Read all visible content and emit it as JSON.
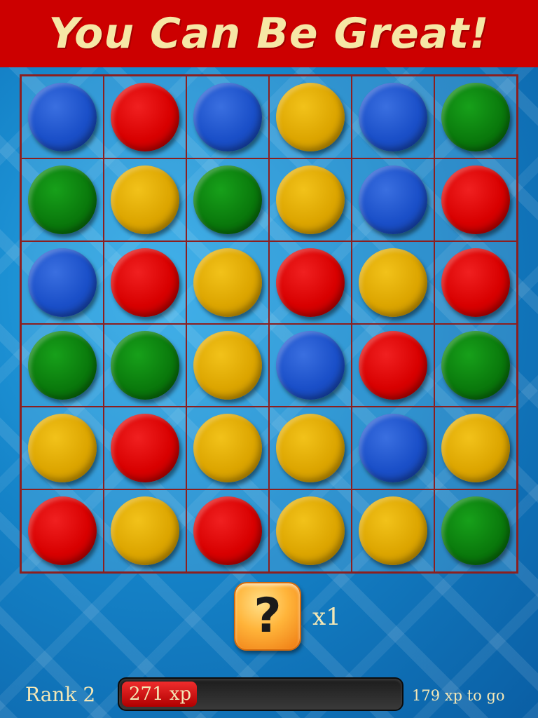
{
  "banner": {
    "title": "You Can Be Great!"
  },
  "board": {
    "rows": 6,
    "cols": 6,
    "cells": [
      [
        "blue",
        "red",
        "blue",
        "yellow",
        "blue",
        "green"
      ],
      [
        "green",
        "yellow",
        "green",
        "yellow",
        "blue",
        "red"
      ],
      [
        "blue",
        "red",
        "yellow",
        "red",
        "yellow",
        "red"
      ],
      [
        "green",
        "green",
        "yellow",
        "blue",
        "red",
        "green"
      ],
      [
        "yellow",
        "red",
        "yellow",
        "yellow",
        "blue",
        "yellow"
      ],
      [
        "red",
        "yellow",
        "red",
        "yellow",
        "yellow",
        "green"
      ]
    ]
  },
  "hint": {
    "icon": "question-mark-icon",
    "glyph": "?",
    "count": "x1"
  },
  "progress": {
    "rank": "Rank 2",
    "xp": "271 xp",
    "to_go": "179 xp to go",
    "fraction": 0.27
  },
  "colors": {
    "banner": "#cc0000",
    "banner_text": "#f6e7a6",
    "grid_lines": "#8b1f1f",
    "blue": "#1a4fc8",
    "red": "#d80000",
    "yellow": "#dca500",
    "green": "#0a7a0c",
    "hint_orange": "#ffb43a",
    "label_text": "#f3e7b6"
  }
}
